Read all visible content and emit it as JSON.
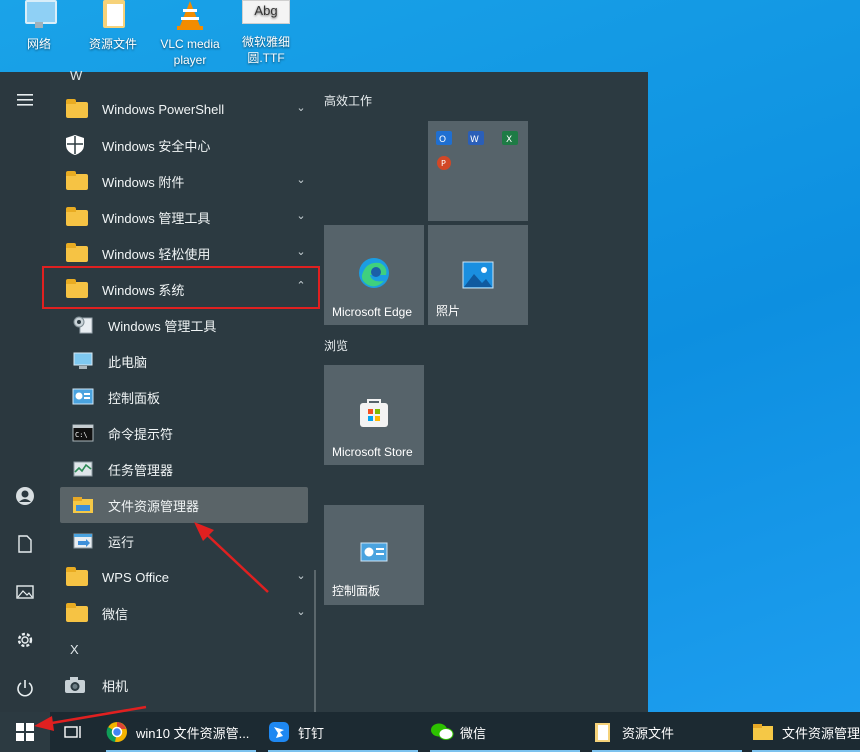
{
  "desktop": {
    "icons": [
      {
        "label": "网络",
        "icon": "network-icon"
      },
      {
        "label": "资源文件",
        "icon": "folder-file-icon"
      },
      {
        "label": "VLC media player",
        "icon": "vlc-cone-icon"
      },
      {
        "label": "微软雅细圆.TTF",
        "icon": "font-file-icon",
        "preview": "Abg"
      }
    ]
  },
  "start_menu": {
    "letters": {
      "w": "W",
      "x": "X"
    },
    "apps": [
      {
        "label": "Windows PowerShell",
        "icon": "folder-icon",
        "chevron": "down"
      },
      {
        "label": "Windows 安全中心",
        "icon": "shield-icon"
      },
      {
        "label": "Windows 附件",
        "icon": "folder-icon",
        "chevron": "down"
      },
      {
        "label": "Windows 管理工具",
        "icon": "folder-icon",
        "chevron": "down"
      },
      {
        "label": "Windows 轻松使用",
        "icon": "folder-icon",
        "chevron": "down"
      },
      {
        "label": "Windows 系统",
        "icon": "folder-icon",
        "chevron": "up",
        "highlighted_by_annotation": true
      },
      {
        "label": "Windows 管理工具",
        "icon": "admin-tools-icon",
        "sub": true
      },
      {
        "label": "此电脑",
        "icon": "this-pc-icon",
        "sub": true
      },
      {
        "label": "控制面板",
        "icon": "control-panel-icon",
        "sub": true
      },
      {
        "label": "命令提示符",
        "icon": "cmd-icon",
        "sub": true
      },
      {
        "label": "任务管理器",
        "icon": "task-manager-icon",
        "sub": true
      },
      {
        "label": "文件资源管理器",
        "icon": "file-explorer-icon",
        "sub": true,
        "hovered": true
      },
      {
        "label": "运行",
        "icon": "run-icon",
        "sub": true
      },
      {
        "label": "WPS Office",
        "icon": "folder-icon",
        "chevron": "down"
      },
      {
        "label": "微信",
        "icon": "folder-icon",
        "chevron": "down"
      },
      {
        "label": "相机",
        "icon": "camera-icon"
      }
    ],
    "tiles": {
      "group1": "高效工作",
      "group2": "浏览",
      "items": [
        {
          "label": "",
          "icon": "office-apps-icon"
        },
        {
          "label": "Microsoft Edge",
          "icon": "edge-icon"
        },
        {
          "label": "照片",
          "icon": "photos-icon"
        },
        {
          "label": "Microsoft Store",
          "icon": "store-icon"
        },
        {
          "label": "控制面板",
          "icon": "control-panel-icon"
        }
      ]
    }
  },
  "taskbar": {
    "items": [
      {
        "label": "win10 文件资源管...",
        "icon": "chrome-like-icon"
      },
      {
        "label": "钉钉",
        "icon": "dingtalk-icon"
      },
      {
        "label": "微信",
        "icon": "wechat-icon"
      },
      {
        "label": "资源文件",
        "icon": "folder-icon"
      },
      {
        "label": "文件资源管理器",
        "icon": "file-explorer-icon"
      }
    ]
  },
  "colors": {
    "annotation_red": "#e02020",
    "desktop_blue": "#0d8fe0",
    "start_bg": "#2c3a41",
    "taskbar_bg": "#1c2a32"
  }
}
